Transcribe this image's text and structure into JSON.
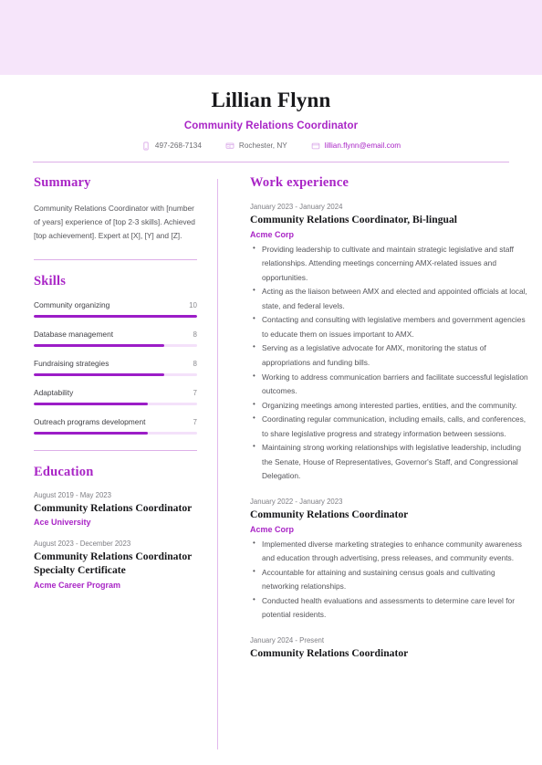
{
  "theme": {
    "banner_color": "#f6e5fa",
    "accent_color": "#a925c6",
    "skill_fill_color": "#9c1dc7",
    "skill_track_color": "#f4e1fa",
    "rule_color": "#ddafe8"
  },
  "header": {
    "name": "Lillian Flynn",
    "job_title": "Community Relations Coordinator",
    "contacts": [
      {
        "icon": "phone-icon",
        "value": "497-268-7134"
      },
      {
        "icon": "location-icon",
        "value": "Rochester, NY"
      },
      {
        "icon": "email-icon",
        "value": "lillian.flynn@email.com"
      }
    ]
  },
  "left": {
    "summary": {
      "heading": "Summary",
      "text": "Community Relations Coordinator with [number of years] experience of [top 2-3 skills]. Achieved [top achievement]. Expert at [X], [Y] and [Z]."
    },
    "skills": {
      "heading": "Skills",
      "max": 10,
      "items": [
        {
          "label": "Community organizing",
          "score": 10
        },
        {
          "label": "Database management",
          "score": 8
        },
        {
          "label": "Fundraising strategies",
          "score": 8
        },
        {
          "label": "Adaptability",
          "score": 7
        },
        {
          "label": "Outreach programs development",
          "score": 7
        }
      ]
    },
    "education": {
      "heading": "Education",
      "items": [
        {
          "date": "August 2019 - May 2023",
          "title": "Community Relations Coordinator",
          "org": "Ace University"
        },
        {
          "date": "August 2023 - December 2023",
          "title": "Community Relations Coordinator Specialty Certificate",
          "org": "Acme Career Program"
        }
      ]
    }
  },
  "right": {
    "work": {
      "heading": "Work experience",
      "items": [
        {
          "date": "January 2023 - January 2024",
          "title": "Community Relations Coordinator, Bi-lingual",
          "org": "Acme Corp",
          "bullets": [
            "Providing leadership to cultivate and maintain strategic legislative and staff relationships. Attending meetings concerning AMX-related issues and opportunities.",
            "Acting as the liaison between AMX and elected and appointed officials at local, state, and federal levels.",
            "Contacting and consulting with legislative members and government agencies to educate them on issues important to AMX.",
            "Serving as a legislative advocate for AMX, monitoring the status of appropriations and funding bills.",
            "Working to address communication barriers and facilitate successful legislation outcomes.",
            "Organizing meetings among interested parties, entities, and the community.",
            "Coordinating regular communication, including emails, calls, and conferences, to share legislative progress and strategy information between sessions.",
            "Maintaining strong working relationships with legislative leadership, including the Senate, House of Representatives, Governor's Staff, and Congressional Delegation."
          ]
        },
        {
          "date": "January 2022 - January 2023",
          "title": "Community Relations Coordinator",
          "org": "Acme Corp",
          "bullets": [
            "Implemented diverse marketing strategies to enhance community awareness and education through advertising, press releases, and community events.",
            "Accountable for attaining and sustaining census goals and cultivating networking relationships.",
            "Conducted health evaluations and assessments to determine care level for potential residents."
          ]
        },
        {
          "date": "January 2024 - Present",
          "title": "Community Relations Coordinator",
          "org": "",
          "bullets": []
        }
      ]
    }
  }
}
